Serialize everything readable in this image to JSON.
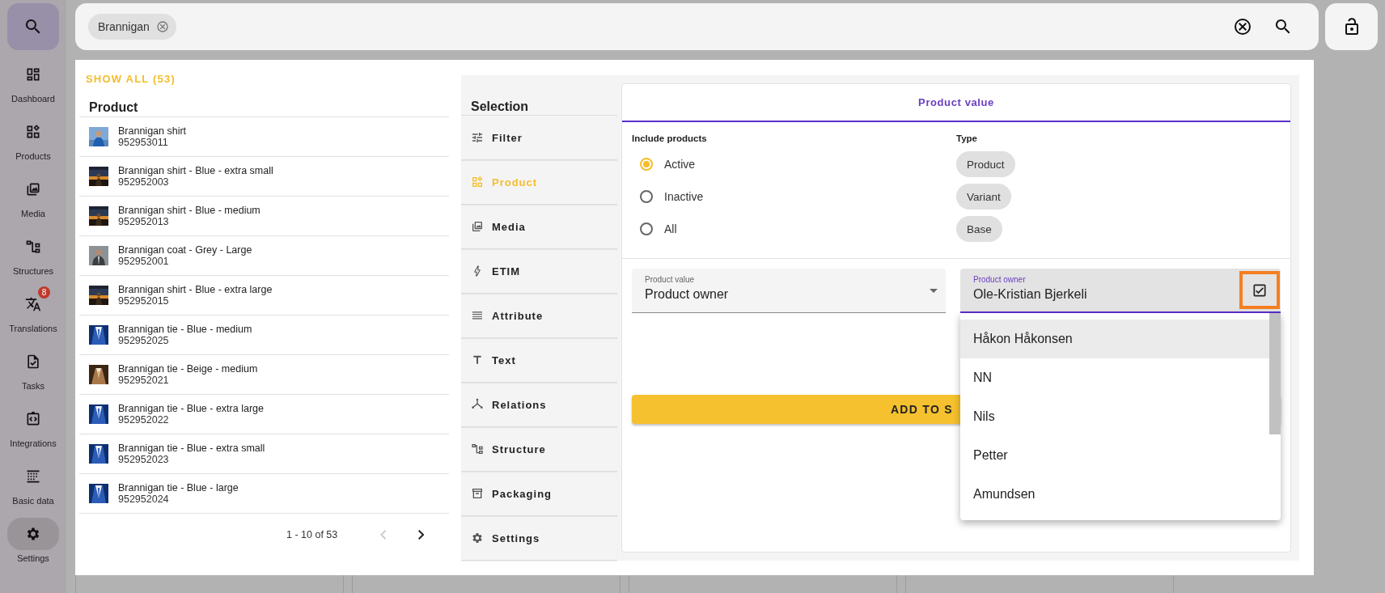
{
  "nav": {
    "items": [
      {
        "label": "Dashboard",
        "selected": false
      },
      {
        "label": "Products",
        "selected": false
      },
      {
        "label": "Media",
        "selected": false
      },
      {
        "label": "Structures",
        "selected": false
      },
      {
        "label": "Translations",
        "selected": false,
        "badge": "8"
      },
      {
        "label": "Tasks",
        "selected": false
      },
      {
        "label": "Integrations",
        "selected": false
      },
      {
        "label": "Basic data",
        "selected": false
      },
      {
        "label": "Settings",
        "selected": true
      }
    ]
  },
  "search": {
    "chips": [
      {
        "label": "Brannigan"
      }
    ]
  },
  "results": {
    "show_all": "SHOW ALL (53)",
    "column": "Product",
    "rows": [
      {
        "name": "Brannigan shirt",
        "number": "952953011"
      },
      {
        "name": "Brannigan shirt - Blue - extra small",
        "number": "952952003"
      },
      {
        "name": "Brannigan shirt - Blue - medium",
        "number": "952952013"
      },
      {
        "name": "Brannigan coat - Grey - Large",
        "number": "952952001"
      },
      {
        "name": "Brannigan shirt - Blue - extra large",
        "number": "952952015"
      },
      {
        "name": "Brannigan tie - Blue - medium",
        "number": "952952025"
      },
      {
        "name": "Brannigan tie - Beige - medium",
        "number": "952952021"
      },
      {
        "name": "Brannigan tie - Blue - extra large",
        "number": "952952022"
      },
      {
        "name": "Brannigan tie - Blue - extra small",
        "number": "952952023"
      },
      {
        "name": "Brannigan tie - Blue - large",
        "number": "952952024"
      }
    ],
    "pagination": {
      "range": "1 - 10 of 53",
      "prev_disabled": true,
      "next_disabled": false
    }
  },
  "selection": {
    "title": "Selection",
    "items": [
      {
        "label": "Filter",
        "selected": false
      },
      {
        "label": "Product",
        "selected": true
      },
      {
        "label": "Media",
        "selected": false
      },
      {
        "label": "ETIM",
        "selected": false
      },
      {
        "label": "Attribute",
        "selected": false
      },
      {
        "label": "Text",
        "selected": false
      },
      {
        "label": "Relations",
        "selected": false
      },
      {
        "label": "Structure",
        "selected": false
      },
      {
        "label": "Packaging",
        "selected": false
      },
      {
        "label": "Settings",
        "selected": false
      }
    ]
  },
  "card": {
    "tab": "Product value",
    "include": {
      "label": "Include products",
      "options": [
        {
          "label": "Active",
          "selected": true
        },
        {
          "label": "Inactive",
          "selected": false
        },
        {
          "label": "All",
          "selected": false
        }
      ]
    },
    "type": {
      "label": "Type",
      "chips": [
        {
          "label": "Product"
        },
        {
          "label": "Variant"
        },
        {
          "label": "Base"
        }
      ]
    },
    "value_field": {
      "label": "Product value",
      "value": "Product owner"
    },
    "owner_field": {
      "label": "Product owner",
      "value": "Ole-Kristian Bjerkeli",
      "focused": true
    },
    "options": [
      {
        "label": "Håkon Håkonsen",
        "selected": true
      },
      {
        "label": "NN",
        "selected": false
      },
      {
        "label": "Nils",
        "selected": false
      },
      {
        "label": "Petter",
        "selected": false
      },
      {
        "label": "Amundsen",
        "selected": false
      }
    ],
    "add_button": "ADD TO S"
  }
}
